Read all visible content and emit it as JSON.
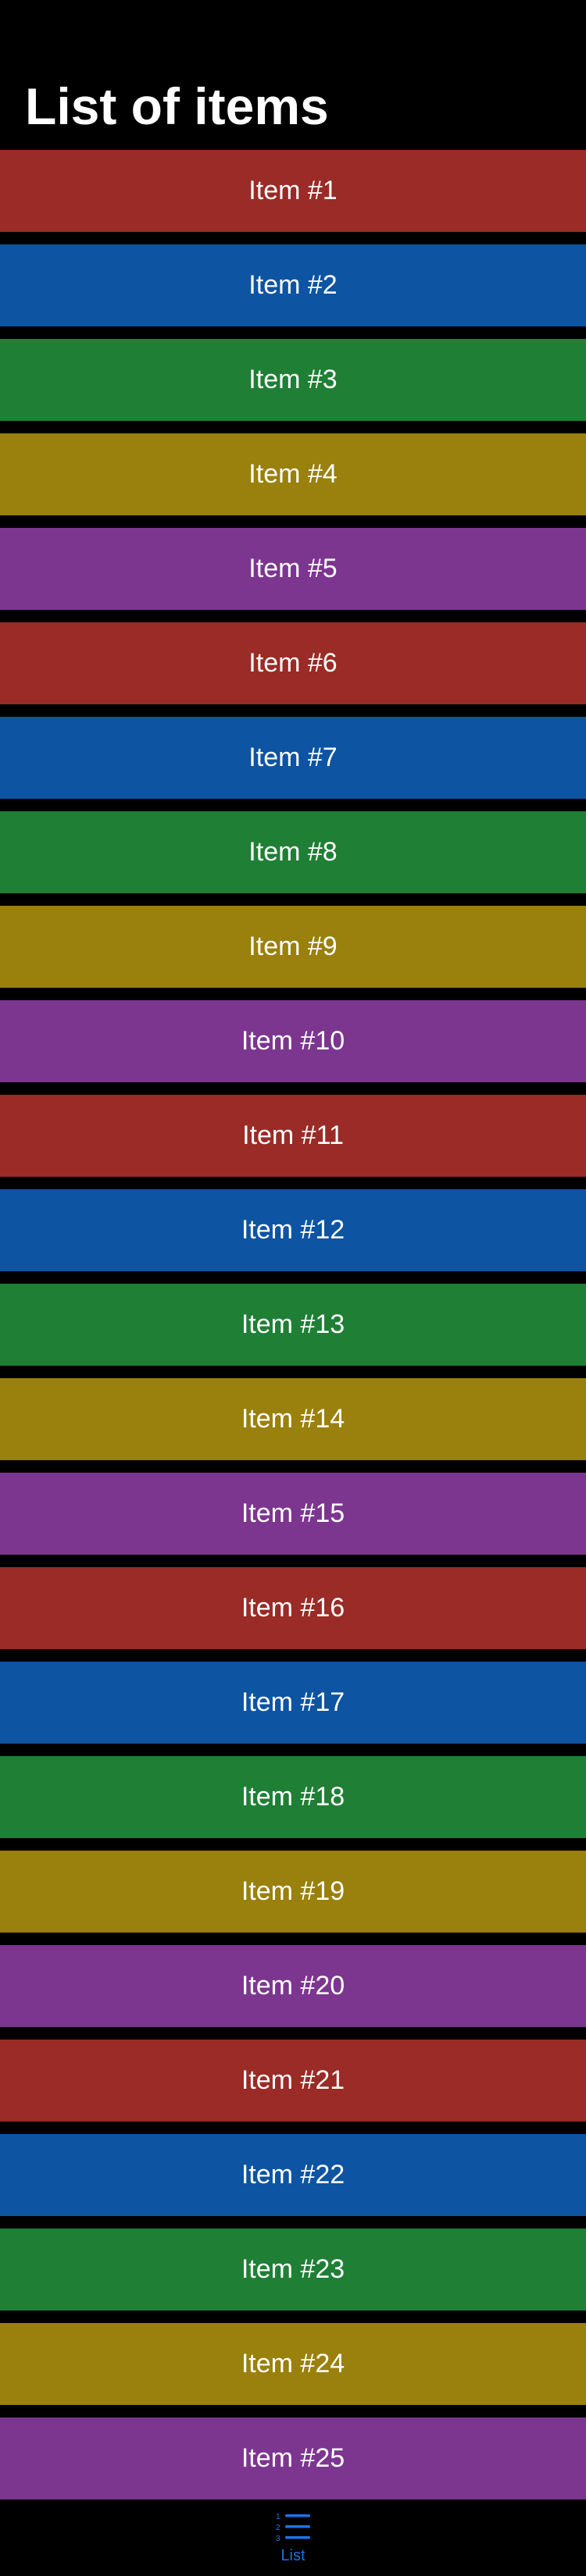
{
  "header": {
    "title": "List of items"
  },
  "list": {
    "row_colors": [
      "#9a2b26",
      "#0d54a2",
      "#1f7f35",
      "#9a800c",
      "#7c3690"
    ],
    "items": [
      "Item #1",
      "Item #2",
      "Item #3",
      "Item #4",
      "Item #5",
      "Item #6",
      "Item #7",
      "Item #8",
      "Item #9",
      "Item #10",
      "Item #11",
      "Item #12",
      "Item #13",
      "Item #14",
      "Item #15",
      "Item #16",
      "Item #17",
      "Item #18",
      "Item #19",
      "Item #20",
      "Item #21",
      "Item #22",
      "Item #23",
      "Item #24",
      "Item #25"
    ]
  },
  "tabbar": {
    "accent": "#1a73e8",
    "tabs": [
      {
        "label": "List",
        "icon": "numbered-list-icon",
        "selected": true
      }
    ]
  }
}
